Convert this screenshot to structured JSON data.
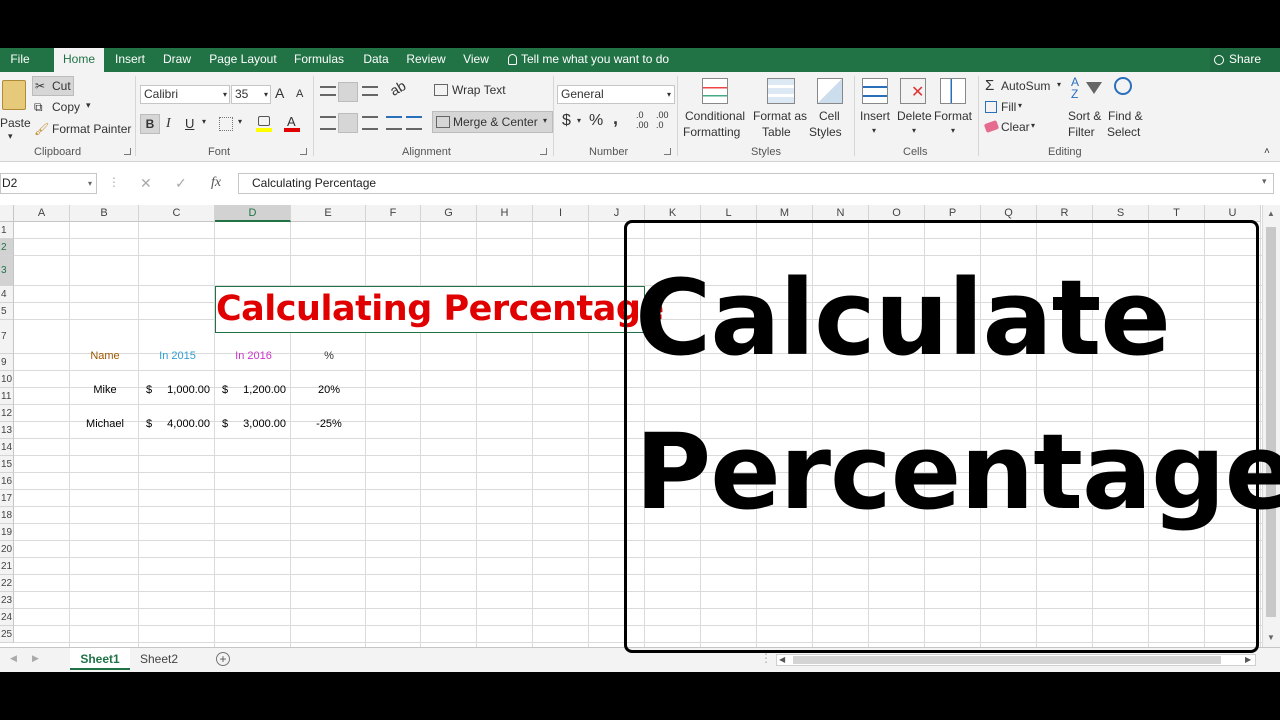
{
  "tabs": [
    "File",
    "Home",
    "Insert",
    "Draw",
    "Page Layout",
    "Formulas",
    "Data",
    "Review",
    "View"
  ],
  "active_tab": "Home",
  "tell_me": "Tell me what you want to do",
  "share": "Share",
  "clipboard": {
    "paste": "Paste",
    "cut": "Cut",
    "copy": "Copy",
    "format_painter": "Format Painter",
    "label": "Clipboard"
  },
  "font": {
    "name": "Calibri",
    "size": "35",
    "bold": "B",
    "italic": "I",
    "underline": "U",
    "grow": "A",
    "shrink": "A",
    "color_letter": "A",
    "label": "Font"
  },
  "alignment": {
    "wrap": "Wrap Text",
    "merge": "Merge & Center",
    "label": "Alignment"
  },
  "number": {
    "format": "General",
    "currency": "$",
    "percent": "%",
    "comma": ",",
    "label": "Number"
  },
  "styles": {
    "conditional": [
      "Conditional",
      "Formatting"
    ],
    "format_table": [
      "Format as",
      "Table"
    ],
    "cell_styles": [
      "Cell",
      "Styles"
    ],
    "label": "Styles"
  },
  "cells": {
    "insert": "Insert",
    "delete": "Delete",
    "format": "Format",
    "label": "Cells"
  },
  "editing": {
    "autosum": "AutoSum",
    "fill": "Fill",
    "clear": "Clear",
    "sort": [
      "Sort &",
      "Filter"
    ],
    "find": [
      "Find &",
      "Select"
    ],
    "label": "Editing"
  },
  "formula_bar": {
    "name_box": "D2",
    "fx": "fx",
    "content": "Calculating Percentage"
  },
  "columns": [
    "A",
    "B",
    "C",
    "D",
    "E",
    "F",
    "G",
    "H",
    "I",
    "J",
    "K",
    "L",
    "M",
    "N",
    "O",
    "P",
    "Q",
    "R",
    "S",
    "T",
    "U"
  ],
  "rows": [
    "1",
    "2",
    "3",
    "4",
    "5",
    "7",
    "9",
    "10",
    "11",
    "12",
    "13",
    "14",
    "15",
    "16",
    "17",
    "18",
    "19",
    "20",
    "21",
    "22",
    "23",
    "24",
    "25"
  ],
  "sheet": {
    "title": "Calculating Percentage",
    "headers": {
      "name": "Name",
      "y2015": "In 2015",
      "y2016": "In 2016",
      "pct": "%"
    },
    "records": [
      {
        "name": "Mike",
        "c_sym": "$",
        "c_val": "1,000.00",
        "d_sym": "$",
        "d_val": "1,200.00",
        "pct": "20%"
      },
      {
        "name": "Michael",
        "c_sym": "$",
        "c_val": "4,000.00",
        "d_sym": "$",
        "d_val": "3,000.00",
        "pct": "-25%"
      }
    ]
  },
  "sheet_tabs": [
    "Sheet1",
    "Sheet2"
  ],
  "overlay": {
    "line1": "Calculate",
    "line2": "Percentage"
  },
  "colors": {
    "excel_green": "#217346",
    "title_red": "#e00000",
    "header_name": "#9c5700",
    "header_2015": "#2e9fd6",
    "header_2016": "#cc33cc"
  }
}
